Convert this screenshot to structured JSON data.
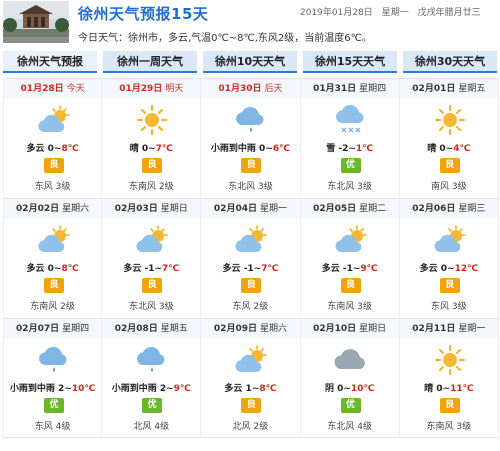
{
  "header": {
    "title": "徐州天气预报15天",
    "date": "2019年01月28日",
    "weekday": "星期一",
    "lunar": "戊戌年腊月廿三",
    "summary": "今日天气：徐州市，多云,气温0℃~8℃,东风2级，当前温度6℃。"
  },
  "tabs": [
    {
      "label": "徐州天气预报"
    },
    {
      "label": "徐州一周天气"
    },
    {
      "label": "徐州10天天气"
    },
    {
      "label": "徐州15天天气"
    },
    {
      "label": "徐州30天天气"
    }
  ],
  "colors": {
    "accent": "#1e6fd0",
    "tab_bg": "#d8e8f8",
    "high_temp": "#d0281f",
    "aqi_liang": "#f0a30a",
    "aqi_you": "#6ab72c"
  },
  "days": [
    {
      "date": "01月28日",
      "week": "今天",
      "red": true,
      "icon": "partly-cloudy-icon",
      "cond": "多云",
      "lo": "0",
      "hi": "8℃",
      "aqi": "良",
      "wind": "东风 3级"
    },
    {
      "date": "01月29日",
      "week": "明天",
      "red": true,
      "icon": "sunny-icon",
      "cond": "晴",
      "lo": "0",
      "hi": "7℃",
      "aqi": "良",
      "wind": "东南风 2级"
    },
    {
      "date": "01月30日",
      "week": "后天",
      "red": true,
      "icon": "light-rain-icon",
      "cond": "小雨到中雨",
      "lo": "0",
      "hi": "6℃",
      "aqi": "良",
      "wind": "东北风 3级"
    },
    {
      "date": "01月31日",
      "week": "星期四",
      "red": false,
      "icon": "snow-icon",
      "cond": "雪",
      "lo": "-2",
      "hi": "1℃",
      "aqi": "优",
      "wind": "东北风 3级"
    },
    {
      "date": "02月01日",
      "week": "星期五",
      "red": false,
      "icon": "sunny-icon",
      "cond": "晴",
      "lo": "0",
      "hi": "4℃",
      "aqi": "良",
      "wind": "南风 3级"
    },
    {
      "date": "02月02日",
      "week": "星期六",
      "red": false,
      "icon": "partly-cloudy-icon",
      "cond": "多云",
      "lo": "0",
      "hi": "8℃",
      "aqi": "良",
      "wind": "东南风 2级"
    },
    {
      "date": "02月03日",
      "week": "星期日",
      "red": false,
      "icon": "partly-cloudy-icon",
      "cond": "多云",
      "lo": "-1",
      "hi": "7℃",
      "aqi": "良",
      "wind": "东北风 3级"
    },
    {
      "date": "02月04日",
      "week": "星期一",
      "red": false,
      "icon": "partly-cloudy-icon",
      "cond": "多云",
      "lo": "-1",
      "hi": "7℃",
      "aqi": "良",
      "wind": "东风 2级"
    },
    {
      "date": "02月05日",
      "week": "星期二",
      "red": false,
      "icon": "partly-cloudy-icon",
      "cond": "多云",
      "lo": "-1",
      "hi": "9℃",
      "aqi": "良",
      "wind": "东南风 3级"
    },
    {
      "date": "02月06日",
      "week": "星期三",
      "red": false,
      "icon": "partly-cloudy-icon",
      "cond": "多云",
      "lo": "0",
      "hi": "12℃",
      "aqi": "良",
      "wind": "东风 3级"
    },
    {
      "date": "02月07日",
      "week": "星期四",
      "red": false,
      "icon": "light-rain-icon",
      "cond": "小雨到中雨",
      "lo": "2",
      "hi": "10℃",
      "aqi": "优",
      "wind": "东风 4级"
    },
    {
      "date": "02月08日",
      "week": "星期五",
      "red": false,
      "icon": "light-rain-icon",
      "cond": "小雨到中雨",
      "lo": "2",
      "hi": "9℃",
      "aqi": "优",
      "wind": "北风 4级"
    },
    {
      "date": "02月09日",
      "week": "星期六",
      "red": false,
      "icon": "partly-cloudy-icon",
      "cond": "多云",
      "lo": "1",
      "hi": "8℃",
      "aqi": "良",
      "wind": "北风 2级"
    },
    {
      "date": "02月10日",
      "week": "星期日",
      "red": false,
      "icon": "overcast-icon",
      "cond": "阴",
      "lo": "0",
      "hi": "10℃",
      "aqi": "优",
      "wind": "东北风 4级"
    },
    {
      "date": "02月11日",
      "week": "星期一",
      "red": false,
      "icon": "sunny-icon",
      "cond": "晴",
      "lo": "0",
      "hi": "11℃",
      "aqi": "良",
      "wind": "东南风 3级"
    }
  ]
}
